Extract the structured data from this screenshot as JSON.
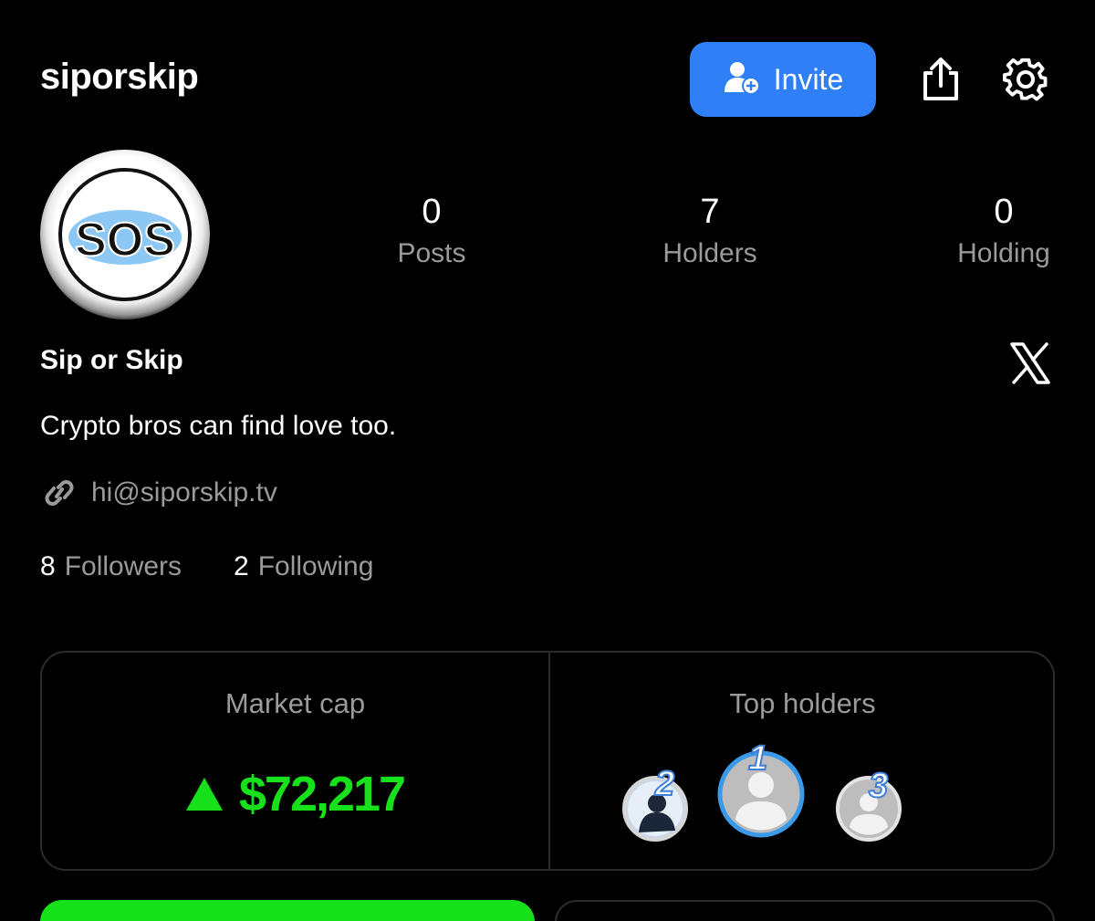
{
  "header": {
    "username": "siporskip",
    "invite_label": "Invite",
    "share_icon": "share-icon",
    "settings_icon": "gear-icon",
    "invite_color": "#2f80f6"
  },
  "profile": {
    "avatar_text": "SOS",
    "display_name": "Sip or Skip",
    "bio": "Crypto bros can find love too.",
    "link": "hi@siporskip.tv",
    "social_icon": "x-logo-icon"
  },
  "stats": [
    {
      "value": "0",
      "label": "Posts"
    },
    {
      "value": "7",
      "label": "Holders"
    },
    {
      "value": "0",
      "label": "Holding"
    }
  ],
  "follow": {
    "followers_count": "8",
    "followers_label": "Followers",
    "following_count": "2",
    "following_label": "Following"
  },
  "market": {
    "title": "Market cap",
    "value": "$72,217",
    "trend": "up",
    "trend_color": "#17e11a"
  },
  "top_holders": {
    "title": "Top holders",
    "ranks": [
      "2",
      "1",
      "3"
    ]
  }
}
